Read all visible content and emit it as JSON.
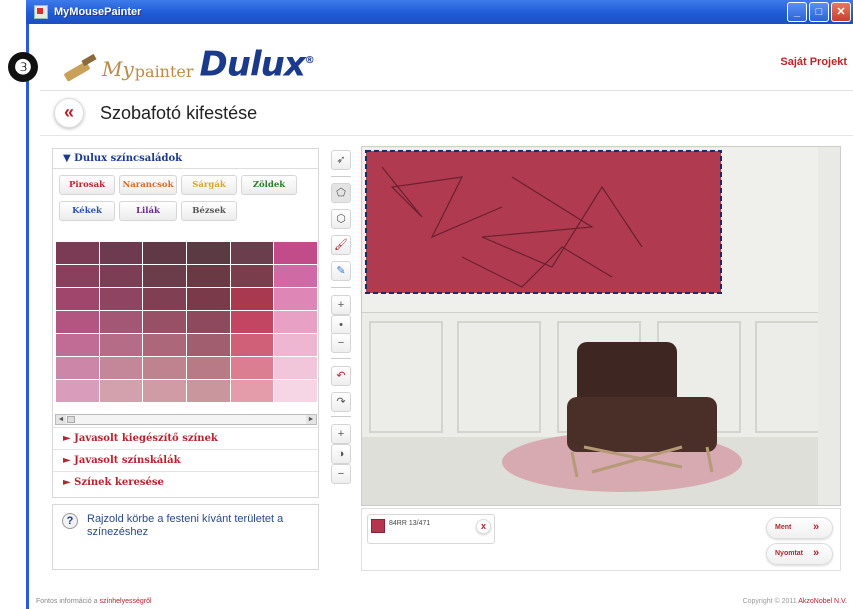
{
  "window": {
    "title": "MyMousePainter"
  },
  "step_badge": "❸",
  "logo": {
    "my": "My",
    "painter": "painter",
    "brand": "Dulux",
    "reg": "®"
  },
  "top_link": "Saját Projekt",
  "back_icon": "«",
  "page_title": "Szobafotó kifestése",
  "left_panel": {
    "section_title": "▼ Dulux színcsaládok",
    "families_row1": [
      "Pirosak",
      "Narancsok",
      "Sárgák",
      "Zöldek"
    ],
    "families_row2": [
      "Kékek",
      "Lilák",
      "Bézsek"
    ],
    "family_colors": [
      "#c0242b",
      "#d86a2a",
      "#d9a52a",
      "#2f7a2f",
      "#2a54b0",
      "#6a2a8a",
      "#555555"
    ],
    "swatch_rows": [
      [
        "#7b3b55",
        "#6e3a4f",
        "#603846",
        "#5c3a43",
        "#6a3e4d",
        "#c24b8a"
      ],
      [
        "#8a3f5c",
        "#7c3e55",
        "#6b3d4a",
        "#693a44",
        "#7a3d4c",
        "#d06aa4"
      ],
      [
        "#a0456b",
        "#8f4461",
        "#803f53",
        "#7a3a4a",
        "#a8394e",
        "#de86b6"
      ],
      [
        "#b35581",
        "#a45775",
        "#985066",
        "#8e4a5c",
        "#c24661",
        "#e8a0c4"
      ],
      [
        "#c06c95",
        "#b56c87",
        "#ad677a",
        "#a15e6e",
        "#d06078",
        "#eeb6d0"
      ],
      [
        "#cc86a7",
        "#c4879a",
        "#bf828f",
        "#b87a85",
        "#dc7e92",
        "#f2c6da"
      ],
      [
        "#d99cba",
        "#d3a0ae",
        "#cf9ca6",
        "#ca969e",
        "#e49caa",
        "#f6d6e4"
      ]
    ],
    "accordions": [
      "► Javasolt kiegészítő színek",
      "► Javasolt színskálák",
      "► Színek keresése"
    ],
    "help_icon": "?",
    "help_text": "Rajzold körbe a festeni kívánt területet a színezéshez"
  },
  "toolbar": {
    "icons": [
      "select-arrow-icon",
      "polygon-paint-icon",
      "polygon-erase-icon",
      "brush-icon",
      "eraser-icon",
      "zoom-in-icon",
      "zoom-dot-icon",
      "zoom-out-icon",
      "undo-icon",
      "redo-icon",
      "brightness-plus-icon",
      "contrast-icon",
      "brightness-minus-icon"
    ],
    "glyphs": [
      "➶",
      "⬠",
      "⬡",
      "🖌",
      "✎",
      "+",
      "•",
      "−",
      "↶",
      "↷",
      "+",
      "◑",
      "−"
    ]
  },
  "selected_color": {
    "code": "84RR 13/471",
    "swatch": "#b5344e",
    "remove": "x"
  },
  "actions": {
    "button1": "Ment",
    "button2": "Nyomtat",
    "arrow": "»"
  },
  "footer": {
    "left_prefix": "Fontos információ a",
    "left_link": "színhelyességről",
    "right_prefix": "Copyright © 2011",
    "right_link": "AkzoNobel N.V."
  },
  "colors": {
    "accent_red": "#b7232f",
    "brand_blue": "#1c3a8c",
    "painted_wall": "#b03a4f",
    "titlebar": "#1f5bd6"
  }
}
